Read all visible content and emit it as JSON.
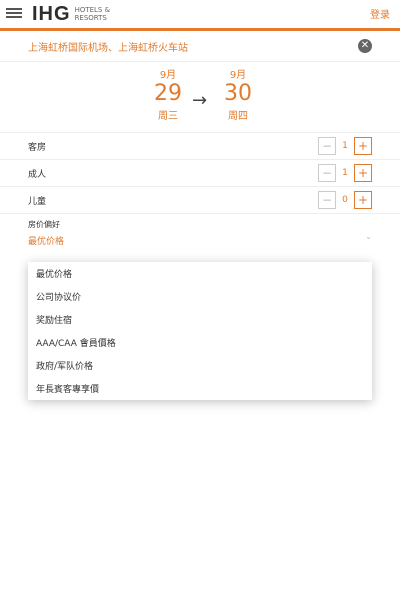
{
  "header": {
    "logo_text": "IHG",
    "logo_sub_1": "HOTELS &",
    "logo_sub_2": "RESORTS",
    "login_label": "登录"
  },
  "location": {
    "value": "上海虹桥国际机场、上海虹桥火车站"
  },
  "dates": {
    "checkin": {
      "month": "9月",
      "day": "29",
      "weekday": "周三"
    },
    "arrow": "→",
    "checkout": {
      "month": "9月",
      "day": "30",
      "weekday": "周四"
    }
  },
  "counts": {
    "rooms": {
      "label": "客房",
      "value": "1"
    },
    "adults": {
      "label": "成人",
      "value": "1"
    },
    "children": {
      "label": "儿童",
      "value": "0"
    },
    "minus": "−",
    "plus": "+"
  },
  "rate_pref": {
    "label": "房价偏好",
    "value": "最优价格",
    "chevron": "⌄"
  },
  "rate_options": [
    "最优价格",
    "公司协议价",
    "奖励住宿",
    "AAA/CAA 會員價格",
    "政府/军队价格",
    "年長賓客專享價"
  ],
  "colors": {
    "accent": "#e27a2c"
  }
}
